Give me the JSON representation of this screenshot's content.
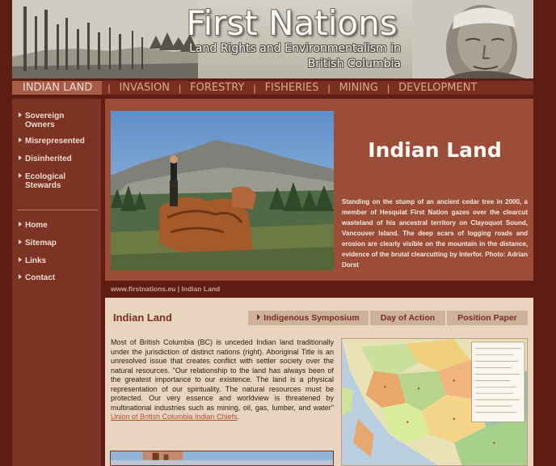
{
  "header": {
    "title": "First Nations",
    "subtitle_line1": "Land Rights and Environmentalism in",
    "subtitle_line2": "British Columbia"
  },
  "topnav": {
    "tabs": [
      {
        "label": "Indian Land",
        "active": true
      },
      {
        "label": "Invasion",
        "active": false
      },
      {
        "label": "Forestry",
        "active": false
      },
      {
        "label": "Fisheries",
        "active": false
      },
      {
        "label": "Mining",
        "active": false
      },
      {
        "label": "Development",
        "active": false
      }
    ]
  },
  "sidebar": {
    "items": [
      {
        "label": "Sovereign Owners"
      },
      {
        "label": "Misrepresented"
      },
      {
        "label": "Disinherited"
      },
      {
        "label": "Ecological Stewards"
      },
      {
        "label": "Home"
      },
      {
        "label": "Sitemap"
      },
      {
        "label": "Links"
      },
      {
        "label": "Contact"
      }
    ]
  },
  "hero": {
    "title": "Indian Land",
    "caption": "Standing on the stump of an ancient cedar tree in 2000, a member of Hesquiat First Nation gazes over the clearcut wasteland of his ancestral territory on Clayoquot Sound, Vancouver Island. The deep scars of logging roads and erosion are clearly visible on the mountain in the distance, evidence of the brutal clearcutting by Interfor.   Photo: Adrian Dorst"
  },
  "breadcrumb": {
    "text": "www.firstnations.eu | Indian Land"
  },
  "main": {
    "title": "Indian Land",
    "subtabs": [
      {
        "label": "Indigenous Symposium",
        "arrow": true
      },
      {
        "label": "Day of Action",
        "arrow": false
      },
      {
        "label": "Position Paper",
        "arrow": false
      }
    ],
    "body": "Most of British Columbia (BC) is unceded Indian land traditionally under the jurisdiction of distinct nations (right). Aboriginal Title is an unresolved issue that creates conflict with settler society over the natural resources. \"Our relationship to the land has always been of the greatest importance to our existence. The land is a physical representation of our spirituality. The natural resources must be protected. Our very essence and worldview is threatened by multinational industries such as mining, oil, gas, lumber, and water\" ",
    "link": "Union of British Columbia Indian Chiefs",
    "after_link": "."
  },
  "colors": {
    "page_bg": "#5e1c12",
    "nav_bg": "#7a2e1f",
    "hero_bg": "#9c4d38",
    "panel_bg": "#e9d5bf",
    "accent": "#7a2e1f"
  }
}
